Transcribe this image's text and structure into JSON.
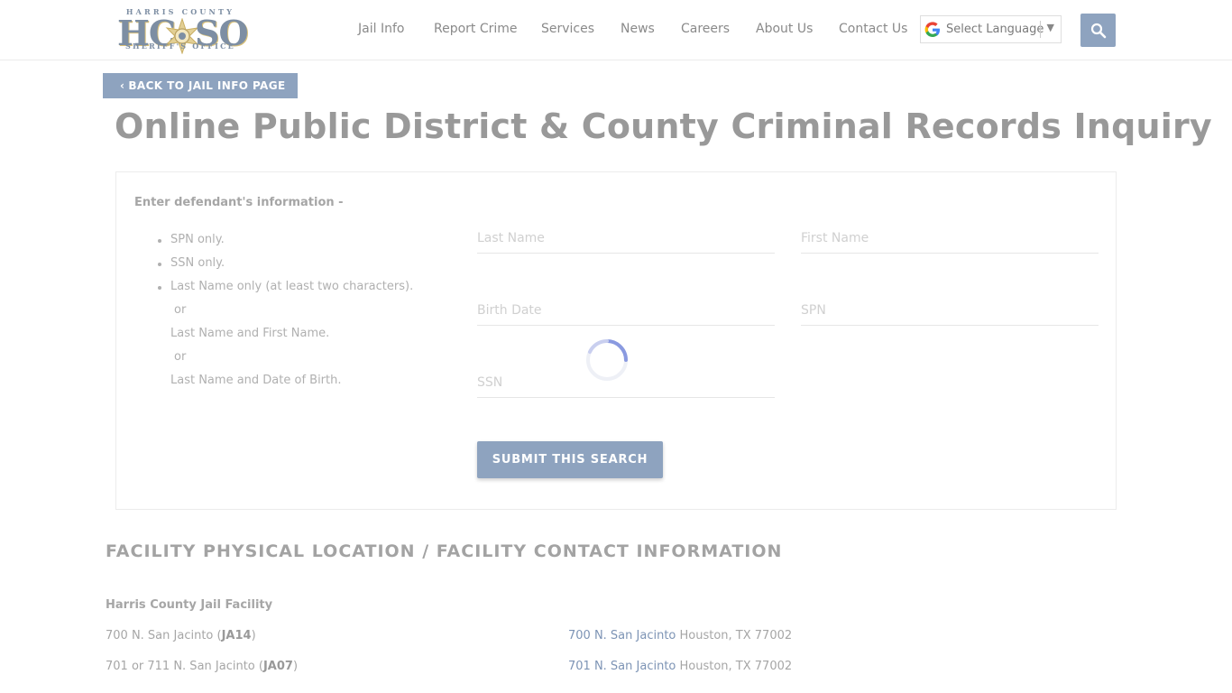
{
  "header": {
    "logo": {
      "top_text": "HARRIS COUNTY",
      "left_letters": "HC",
      "right_letters": "SO",
      "bottom_text": "SHERIFF'S OFFICE"
    },
    "nav": [
      {
        "label": "Jail Info"
      },
      {
        "label": "Report Crime"
      },
      {
        "label": "Services"
      },
      {
        "label": "News"
      },
      {
        "label": "Careers"
      },
      {
        "label": "About Us"
      },
      {
        "label": "Contact Us"
      }
    ],
    "language_select": {
      "label": "Select Language",
      "arrow": "▼"
    },
    "search_icon": "search-icon"
  },
  "back_button": {
    "label": "BACK TO JAIL INFO PAGE",
    "icon": "chevron-left-icon"
  },
  "page_title": "Online Public District & County Criminal Records Inquiry",
  "form": {
    "intro": "Enter defendant's information -",
    "instructions": [
      {
        "text": "SPN only.",
        "bullet": true
      },
      {
        "text": "SSN only.",
        "bullet": true
      },
      {
        "text": "Last Name only (at least two characters).",
        "bullet": true
      },
      {
        "text": "or",
        "bullet": false
      },
      {
        "text": "Last Name and First Name.",
        "bullet": false
      },
      {
        "text": "or",
        "bullet": false
      },
      {
        "text": "Last Name and Date of Birth.",
        "bullet": false
      }
    ],
    "fields": {
      "last_name": {
        "placeholder": "Last Name",
        "value": ""
      },
      "first_name": {
        "placeholder": "First Name",
        "value": ""
      },
      "birth_date": {
        "placeholder": "Birth Date",
        "value": ""
      },
      "spn": {
        "placeholder": "SPN",
        "value": ""
      },
      "ssn": {
        "placeholder": "SSN",
        "value": ""
      }
    },
    "submit_label": "SUBMIT THIS SEARCH"
  },
  "facility": {
    "heading": "FACILITY PHYSICAL LOCATION / FACILITY CONTACT INFORMATION",
    "name": "Harris County Jail Facility",
    "rows": [
      {
        "address": "700 N. San Jacinto (",
        "code": "JA14",
        "close": ")",
        "link": "700 N. San Jacinto",
        "city": " Houston, TX 77002"
      },
      {
        "address": "701 or 711 N. San Jacinto (",
        "code": "JA07",
        "close": ")",
        "link": "701 N. San Jacinto",
        "city": " Houston, TX 77002"
      }
    ]
  },
  "colors": {
    "accent": "#8ea3bf",
    "link": "#7d94b5",
    "logo_gold": "#d8c07a"
  }
}
